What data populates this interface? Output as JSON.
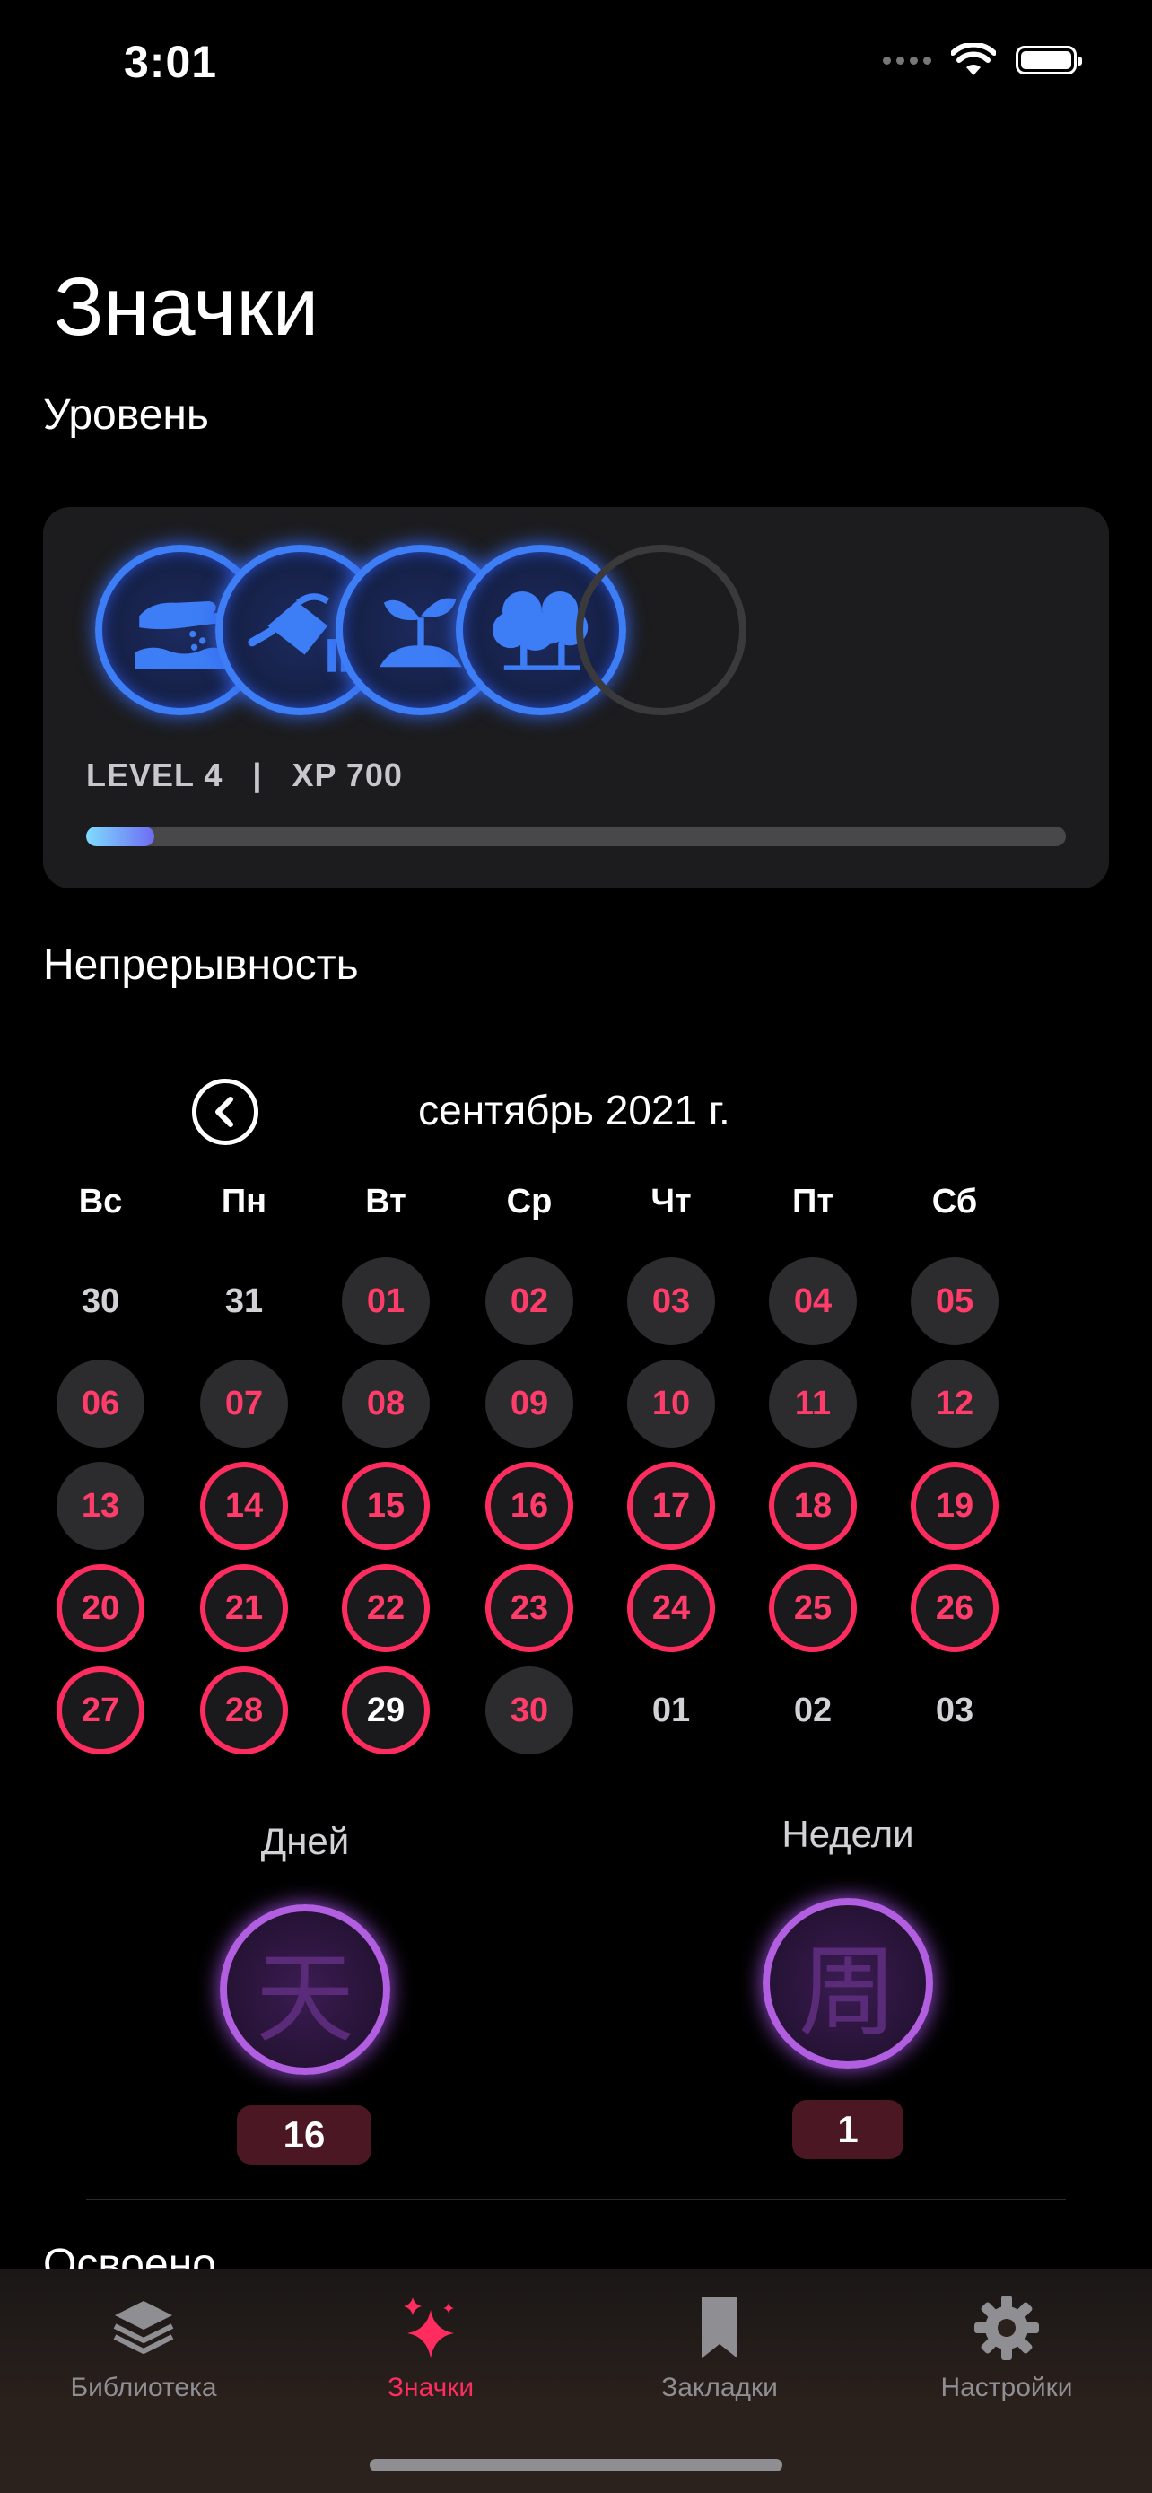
{
  "status_bar": {
    "time": "3:01"
  },
  "page_title": "Значки",
  "level_section": {
    "title": "Уровень",
    "level_label": "LEVEL 4",
    "separator": "|",
    "xp_label": "XP 700",
    "xp_progress": 0.07,
    "badges": [
      {
        "icon": "hand-sowing-icon",
        "unlocked": true
      },
      {
        "icon": "watering-can-icon",
        "unlocked": true
      },
      {
        "icon": "sprout-icon",
        "unlocked": true
      },
      {
        "icon": "trees-icon",
        "unlocked": true
      },
      {
        "icon": "locked-badge-icon",
        "unlocked": false
      }
    ]
  },
  "streak_section": {
    "title": "Непрерывность",
    "calendar": {
      "month_label": "сентябрь 2021 г.",
      "weekdays": [
        "Вс",
        "Пн",
        "Вт",
        "Ср",
        "Чт",
        "Пт",
        "Сб"
      ],
      "weeks": [
        [
          {
            "d": "30",
            "s": "plain"
          },
          {
            "d": "31",
            "s": "plain"
          },
          {
            "d": "01",
            "s": "gray"
          },
          {
            "d": "02",
            "s": "gray"
          },
          {
            "d": "03",
            "s": "gray"
          },
          {
            "d": "04",
            "s": "gray"
          },
          {
            "d": "05",
            "s": "gray"
          }
        ],
        [
          {
            "d": "06",
            "s": "gray"
          },
          {
            "d": "07",
            "s": "gray"
          },
          {
            "d": "08",
            "s": "gray"
          },
          {
            "d": "09",
            "s": "gray"
          },
          {
            "d": "10",
            "s": "gray"
          },
          {
            "d": "11",
            "s": "gray"
          },
          {
            "d": "12",
            "s": "gray"
          }
        ],
        [
          {
            "d": "13",
            "s": "gray"
          },
          {
            "d": "14",
            "s": "ring"
          },
          {
            "d": "15",
            "s": "ring"
          },
          {
            "d": "16",
            "s": "ring"
          },
          {
            "d": "17",
            "s": "ring"
          },
          {
            "d": "18",
            "s": "ring"
          },
          {
            "d": "19",
            "s": "ring"
          }
        ],
        [
          {
            "d": "20",
            "s": "ring"
          },
          {
            "d": "21",
            "s": "ring"
          },
          {
            "d": "22",
            "s": "ring"
          },
          {
            "d": "23",
            "s": "ring"
          },
          {
            "d": "24",
            "s": "ring"
          },
          {
            "d": "25",
            "s": "ring"
          },
          {
            "d": "26",
            "s": "ring"
          }
        ],
        [
          {
            "d": "27",
            "s": "ring"
          },
          {
            "d": "28",
            "s": "ring"
          },
          {
            "d": "29",
            "s": "today"
          },
          {
            "d": "30",
            "s": "gray"
          },
          {
            "d": "01",
            "s": "plain"
          },
          {
            "d": "02",
            "s": "plain"
          },
          {
            "d": "03",
            "s": "plain"
          }
        ]
      ]
    },
    "days": {
      "label": "Дней",
      "glyph": "天",
      "count": "16"
    },
    "weeks_streak": {
      "label": "Недели",
      "glyph": "周",
      "count": "1"
    }
  },
  "next_section_title": "Освоено",
  "tab_bar": {
    "tabs": [
      {
        "label": "Библиотека",
        "icon": "stack-icon",
        "active": false
      },
      {
        "label": "Значки",
        "icon": "sparkles-icon",
        "active": true
      },
      {
        "label": "Закладки",
        "icon": "bookmark-icon",
        "active": false
      },
      {
        "label": "Настройки",
        "icon": "gear-icon",
        "active": false
      }
    ]
  },
  "colors": {
    "accent": "#ff2d5f",
    "badge_blue": "#3d7df5",
    "badge_purple": "#b15fe0"
  }
}
